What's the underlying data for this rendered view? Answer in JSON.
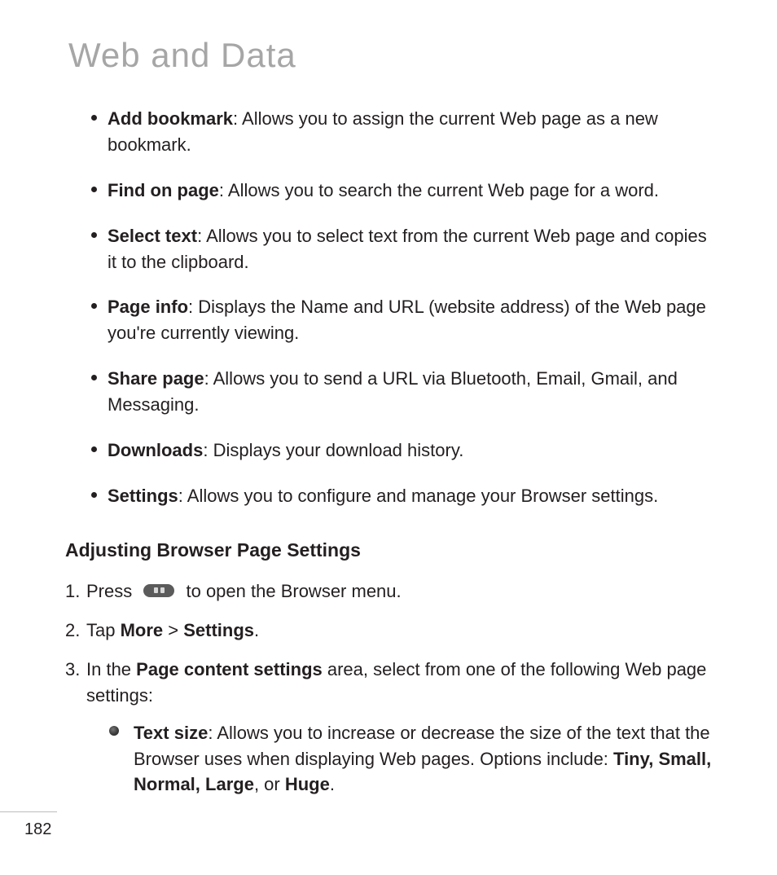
{
  "title": "Web and Data",
  "bullets": [
    {
      "label": "Add bookmark",
      "text": ": Allows you to assign the current Web page as a new bookmark."
    },
    {
      "label": "Find on page",
      "text": ": Allows you to search the current Web page for a word."
    },
    {
      "label": "Select text",
      "text": ": Allows you to select text from the current Web page and copies it to the clipboard."
    },
    {
      "label": "Page info",
      "text": ": Displays the Name and URL (website address) of the Web page you're currently viewing."
    },
    {
      "label": "Share page",
      "text": ": Allows you to send a URL via Bluetooth, Email, Gmail, and Messaging."
    },
    {
      "label": "Downloads",
      "text": ": Displays your download history."
    },
    {
      "label": "Settings",
      "text": ": Allows you to configure and manage your Browser settings."
    }
  ],
  "subhead": "Adjusting Browser Page Settings",
  "steps": {
    "s1_pre": "Press ",
    "s1_post": " to open the Browser menu.",
    "s2_pre": "Tap ",
    "s2_more": "More",
    "s2_sep": " > ",
    "s2_settings": "Settings",
    "s2_post": ".",
    "s3_pre": "In the ",
    "s3_bold": "Page content settings",
    "s3_post": " area, select from one of the following Web page settings:"
  },
  "subbullet": {
    "label": "Text size",
    "pre": ": Allows you to increase or decrease the size of the text that the Browser uses when displaying Web pages. Options include: ",
    "opts1": "Tiny, Small, Normal, Large",
    "mid": ", or ",
    "opts2": "Huge",
    "post": "."
  },
  "pageNumber": "182"
}
